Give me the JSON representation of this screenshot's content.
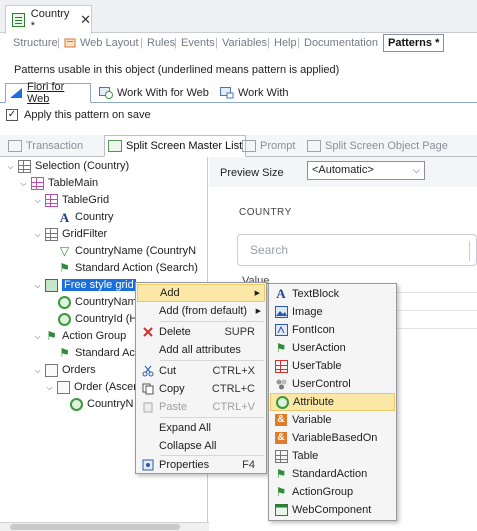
{
  "document_tab": {
    "title": "Country *",
    "close": "✕"
  },
  "parts": {
    "items": [
      "Structure",
      "Web Layout",
      "Rules",
      "Events",
      "Variables",
      "Help",
      "Documentation"
    ],
    "active": "Patterns *"
  },
  "hint": "Patterns usable in this object (underlined means pattern is applied)",
  "pattern_tabs": [
    "Fiori for Web",
    "Work With for Web",
    "Work With"
  ],
  "apply_checkbox": {
    "label": "Apply this pattern on save",
    "checked": true
  },
  "sub_tabs": {
    "transaction": "Transaction",
    "split_master": "Split Screen Master List",
    "prompt": "Prompt",
    "split_object": "Split Screen Object Page"
  },
  "tree": {
    "selection": "Selection (Country)",
    "table_main": "TableMain",
    "table_grid": "TableGrid",
    "country": "Country",
    "grid_filter": "GridFilter",
    "country_name": "CountryName (CountryN",
    "std_action": "Standard Action (Search)",
    "free_grid": "Free style grid",
    "country_nam": "CountryNam",
    "country_id": "CountryId (H",
    "action_group": "Action Group",
    "standard_ac": "Standard Ac",
    "orders": "Orders",
    "order": "Order (Ascen",
    "country_n": "CountryN"
  },
  "preview": {
    "label": "Preview Size",
    "value": "<Automatic>"
  },
  "canvas": {
    "heading": "COUNTRY",
    "search_placeholder": "Search",
    "value_label": "Value"
  },
  "context_menu": {
    "add": "Add",
    "add_default": "Add (from default)",
    "delete": "Delete",
    "delete_sc": "SUPR",
    "add_all": "Add all attributes",
    "cut": "Cut",
    "cut_sc": "CTRL+X",
    "copy": "Copy",
    "copy_sc": "CTRL+C",
    "paste": "Paste",
    "paste_sc": "CTRL+V",
    "expand_all": "Expand All",
    "collapse_all": "Collapse All",
    "properties": "Properties",
    "properties_sc": "F4"
  },
  "submenu": [
    "TextBlock",
    "Image",
    "FontIcon",
    "UserAction",
    "UserTable",
    "UserControl",
    "Attribute",
    "Variable",
    "VariableBasedOn",
    "Table",
    "StandardAction",
    "ActionGroup",
    "WebComponent"
  ],
  "submenu_highlight": "Attribute",
  "colors": {
    "selection": "#1a6fdb",
    "menu_highlight": "#fbe7a6",
    "action_green": "#2e8b3a",
    "grid_magenta": "#c24fb0"
  }
}
